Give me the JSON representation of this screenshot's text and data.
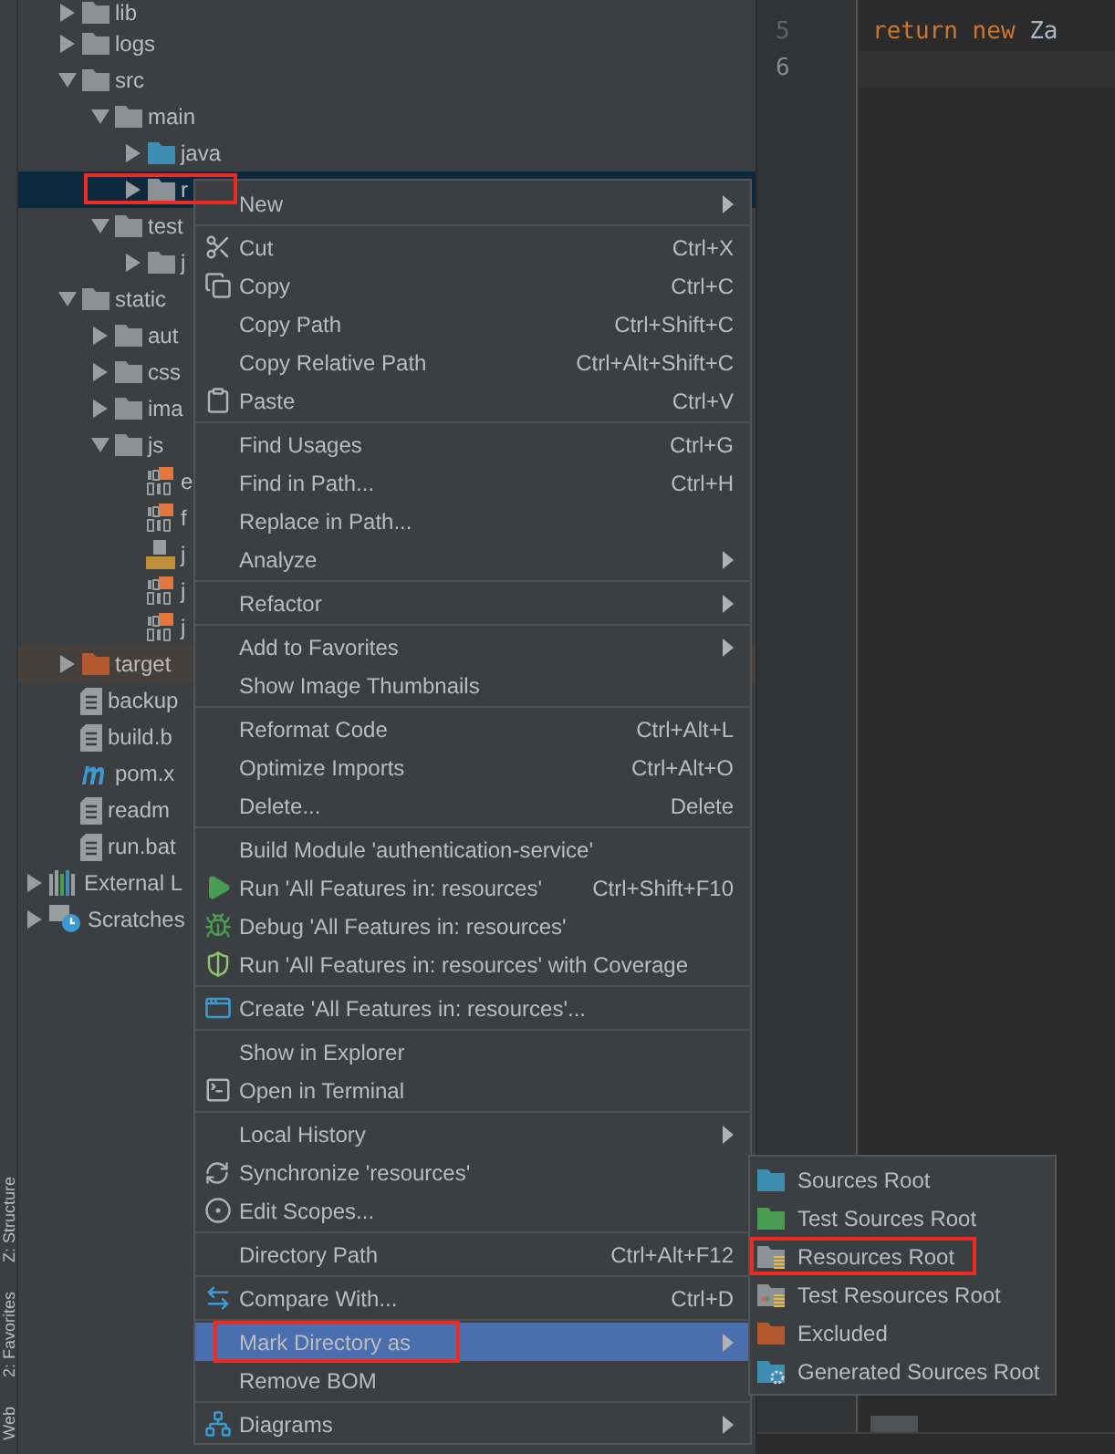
{
  "side_strip": {
    "tabs": [
      "Z: Structure",
      "2: Favorites",
      "Web"
    ]
  },
  "project_tree": {
    "children": [
      {
        "name": "lib",
        "kind": "folder",
        "expanded": false,
        "selected": false,
        "highlighted": false
      },
      {
        "name": "logs",
        "kind": "folder",
        "expanded": false,
        "selected": false,
        "highlighted": false
      },
      {
        "name": "src",
        "kind": "folder",
        "expanded": true,
        "selected": false,
        "highlighted": false,
        "children": [
          {
            "name": "main",
            "kind": "folder",
            "expanded": true,
            "selected": false,
            "highlighted": false,
            "children": [
              {
                "name": "java",
                "kind": "source_folder",
                "expanded": false,
                "selected": false,
                "highlighted": false
              },
              {
                "name": "r",
                "kind": "folder",
                "expanded": false,
                "selected": true,
                "highlighted": true
              }
            ]
          },
          {
            "name": "test",
            "kind": "folder",
            "expanded": true,
            "selected": false,
            "highlighted": false,
            "children": [
              {
                "name": "j",
                "kind": "folder",
                "expanded": false,
                "selected": false,
                "highlighted": false
              }
            ]
          }
        ]
      },
      {
        "name": "static",
        "kind": "folder",
        "expanded": true,
        "selected": false,
        "highlighted": false,
        "children": [
          {
            "name": "aut",
            "kind": "folder",
            "expanded": false,
            "selected": false,
            "highlighted": false
          },
          {
            "name": "css",
            "kind": "folder",
            "expanded": false,
            "selected": false,
            "highlighted": false
          },
          {
            "name": "ima",
            "kind": "folder",
            "expanded": false,
            "selected": false,
            "highlighted": false
          },
          {
            "name": "js",
            "kind": "folder",
            "expanded": true,
            "selected": false,
            "highlighted": false,
            "children": [
              {
                "name": "e",
                "kind": "binary_js",
                "selected": false,
                "highlighted": false
              },
              {
                "name": "f",
                "kind": "binary_js",
                "selected": false,
                "highlighted": false
              },
              {
                "name": "j",
                "kind": "js_file",
                "selected": false,
                "highlighted": false
              },
              {
                "name": "j",
                "kind": "binary_js",
                "selected": false,
                "highlighted": false
              },
              {
                "name": "j",
                "kind": "binary_js",
                "selected": false,
                "highlighted": false
              }
            ]
          }
        ]
      },
      {
        "name": "target",
        "kind": "excluded_folder",
        "expanded": false,
        "selected": false,
        "highlighted": false
      },
      {
        "name": "backup",
        "kind": "text_file",
        "selected": false,
        "highlighted": false
      },
      {
        "name": "build.b",
        "kind": "text_file",
        "selected": false,
        "highlighted": false
      },
      {
        "name": "pom.x",
        "kind": "maven_file",
        "selected": false,
        "highlighted": false
      },
      {
        "name": "readm",
        "kind": "text_file",
        "selected": false,
        "highlighted": false
      },
      {
        "name": "run.bat",
        "kind": "text_file",
        "selected": false,
        "highlighted": false
      }
    ]
  },
  "tree_roots": [
    {
      "name": "External L",
      "kind": "library",
      "expanded": false,
      "selected": false,
      "highlighted": false
    },
    {
      "name": "Scratches",
      "kind": "scratches",
      "expanded": false,
      "selected": false,
      "highlighted": false
    }
  ],
  "editor": {
    "lines": [
      {
        "number": "5",
        "current": false,
        "tokens": [
          {
            "text": "return new ",
            "kind": "keyword"
          },
          {
            "text": "Za",
            "kind": "plain"
          }
        ]
      },
      {
        "number": "6",
        "current": true
      }
    ]
  },
  "context_menu": {
    "items": [
      {
        "kind": "submenu",
        "label": "New",
        "selected": false,
        "highlighted": false
      },
      {
        "kind": "separator"
      },
      {
        "kind": "command",
        "label": "Cut",
        "shortcut": "Ctrl+X",
        "selected": false,
        "highlighted": false
      },
      {
        "kind": "command",
        "label": "Copy",
        "shortcut": "Ctrl+C",
        "selected": false,
        "highlighted": false
      },
      {
        "kind": "command",
        "label": "Copy Path",
        "shortcut": "Ctrl+Shift+C",
        "selected": false,
        "highlighted": false
      },
      {
        "kind": "command",
        "label": "Copy Relative Path",
        "shortcut": "Ctrl+Alt+Shift+C",
        "selected": false,
        "highlighted": false
      },
      {
        "kind": "command",
        "label": "Paste",
        "shortcut": "Ctrl+V",
        "selected": false,
        "highlighted": false
      },
      {
        "kind": "separator"
      },
      {
        "kind": "command",
        "label": "Find Usages",
        "shortcut": "Ctrl+G",
        "selected": false,
        "highlighted": false
      },
      {
        "kind": "command",
        "label": "Find in Path...",
        "shortcut": "Ctrl+H",
        "selected": false,
        "highlighted": false
      },
      {
        "kind": "command",
        "label": "Replace in Path...",
        "selected": false,
        "highlighted": false
      },
      {
        "kind": "submenu",
        "label": "Analyze",
        "selected": false,
        "highlighted": false
      },
      {
        "kind": "separator"
      },
      {
        "kind": "submenu",
        "label": "Refactor",
        "selected": false,
        "highlighted": false
      },
      {
        "kind": "separator"
      },
      {
        "kind": "submenu",
        "label": "Add to Favorites",
        "selected": false,
        "highlighted": false
      },
      {
        "kind": "command",
        "label": "Show Image Thumbnails",
        "selected": false,
        "highlighted": false
      },
      {
        "kind": "separator"
      },
      {
        "kind": "command",
        "label": "Reformat Code",
        "shortcut": "Ctrl+Alt+L",
        "selected": false,
        "highlighted": false
      },
      {
        "kind": "command",
        "label": "Optimize Imports",
        "shortcut": "Ctrl+Alt+O",
        "selected": false,
        "highlighted": false
      },
      {
        "kind": "command",
        "label": "Delete...",
        "shortcut": "Delete",
        "selected": false,
        "highlighted": false
      },
      {
        "kind": "separator"
      },
      {
        "kind": "command",
        "label": "Build Module 'authentication-service'",
        "selected": false,
        "highlighted": false
      },
      {
        "kind": "command",
        "label": "Run 'All Features in: resources'",
        "shortcut": "Ctrl+Shift+F10",
        "selected": false,
        "highlighted": false
      },
      {
        "kind": "command",
        "label": "Debug 'All Features in: resources'",
        "selected": false,
        "highlighted": false
      },
      {
        "kind": "command",
        "label": "Run 'All Features in: resources' with Coverage",
        "selected": false,
        "highlighted": false
      },
      {
        "kind": "separator"
      },
      {
        "kind": "command",
        "label": "Create 'All Features in: resources'...",
        "selected": false,
        "highlighted": false
      },
      {
        "kind": "separator"
      },
      {
        "kind": "command",
        "label": "Show in Explorer",
        "selected": false,
        "highlighted": false
      },
      {
        "kind": "command",
        "label": "Open in Terminal",
        "selected": false,
        "highlighted": false
      },
      {
        "kind": "separator"
      },
      {
        "kind": "submenu",
        "label": "Local History",
        "selected": false,
        "highlighted": false
      },
      {
        "kind": "command",
        "label": "Synchronize 'resources'",
        "selected": false,
        "highlighted": false
      },
      {
        "kind": "command",
        "label": "Edit Scopes...",
        "selected": false,
        "highlighted": false
      },
      {
        "kind": "separator"
      },
      {
        "kind": "command",
        "label": "Directory Path",
        "shortcut": "Ctrl+Alt+F12",
        "selected": false,
        "highlighted": false
      },
      {
        "kind": "separator"
      },
      {
        "kind": "command",
        "label": "Compare With...",
        "shortcut": "Ctrl+D",
        "selected": false,
        "highlighted": false
      },
      {
        "kind": "separator"
      },
      {
        "kind": "submenu",
        "label": "Mark Directory as",
        "selected": true,
        "highlighted": true
      },
      {
        "kind": "command",
        "label": "Remove BOM",
        "selected": false,
        "highlighted": false
      },
      {
        "kind": "separator"
      },
      {
        "kind": "submenu",
        "label": "Diagrams",
        "selected": false,
        "highlighted": false
      }
    ]
  },
  "submenu": {
    "items": [
      {
        "label": "Sources Root",
        "color": "#3d8eb0",
        "selected": false,
        "highlighted": false
      },
      {
        "label": "Test Sources Root",
        "color": "#499c54",
        "selected": false,
        "highlighted": false
      },
      {
        "label": "Resources Root",
        "color": "#8c9195",
        "selected": false,
        "highlighted": true
      },
      {
        "label": "Test Resources Root",
        "color": "#8c9195",
        "selected": false,
        "highlighted": false
      },
      {
        "label": "Excluded",
        "color": "#b3582f",
        "selected": false,
        "highlighted": false
      },
      {
        "label": "Generated Sources Root",
        "color": "#3d8eb0",
        "selected": false,
        "highlighted": false
      }
    ]
  }
}
